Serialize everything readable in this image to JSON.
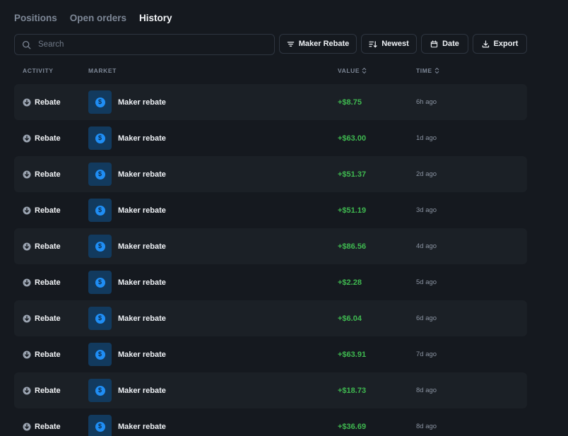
{
  "tabs": [
    {
      "label": "Positions",
      "active": false
    },
    {
      "label": "Open orders",
      "active": false
    },
    {
      "label": "History",
      "active": true
    }
  ],
  "search": {
    "placeholder": "Search",
    "value": ""
  },
  "toolbar": {
    "filter_label": "Maker Rebate",
    "sort_label": "Newest",
    "date_label": "Date",
    "export_label": "Export"
  },
  "table": {
    "headers": {
      "activity": "ACTIVITY",
      "market": "MARKET",
      "value": "VALUE",
      "time": "TIME"
    },
    "rows": [
      {
        "activity": "Rebate",
        "market": "Maker rebate",
        "value": "+$8.75",
        "time": "6h ago"
      },
      {
        "activity": "Rebate",
        "market": "Maker rebate",
        "value": "+$63.00",
        "time": "1d ago"
      },
      {
        "activity": "Rebate",
        "market": "Maker rebate",
        "value": "+$51.37",
        "time": "2d ago"
      },
      {
        "activity": "Rebate",
        "market": "Maker rebate",
        "value": "+$51.19",
        "time": "3d ago"
      },
      {
        "activity": "Rebate",
        "market": "Maker rebate",
        "value": "+$86.56",
        "time": "4d ago"
      },
      {
        "activity": "Rebate",
        "market": "Maker rebate",
        "value": "+$2.28",
        "time": "5d ago"
      },
      {
        "activity": "Rebate",
        "market": "Maker rebate",
        "value": "+$6.04",
        "time": "6d ago"
      },
      {
        "activity": "Rebate",
        "market": "Maker rebate",
        "value": "+$63.91",
        "time": "7d ago"
      },
      {
        "activity": "Rebate",
        "market": "Maker rebate",
        "value": "+$18.73",
        "time": "8d ago"
      },
      {
        "activity": "Rebate",
        "market": "Maker rebate",
        "value": "+$36.69",
        "time": "8d ago"
      }
    ]
  },
  "icons": {
    "activity": "arrow-down-circle-icon",
    "market": "dollar-coin-icon",
    "search": "search-icon",
    "filter": "filter-icon",
    "sort": "sort-icon",
    "date": "calendar-icon",
    "export": "download-icon"
  },
  "colors": {
    "background": "#15191f",
    "row_shade": "#1b2026",
    "positive": "#3fb950",
    "market_icon_bg": "#123a5e",
    "coin": "#1f8ef5"
  }
}
